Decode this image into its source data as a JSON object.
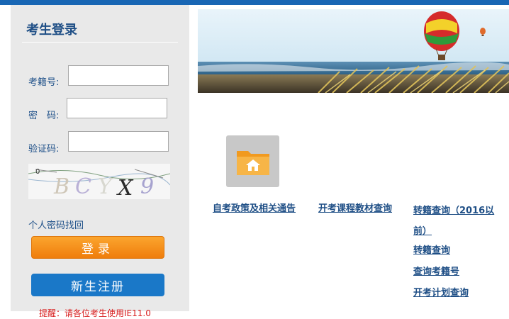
{
  "login": {
    "title": "考生登录",
    "exam_no_label": "考籍号:",
    "exam_no_value": "",
    "password_label": "密　码:",
    "password_value": "",
    "captcha_label": "验证码:",
    "captcha_value": "",
    "captcha_image_text": "BCYX9",
    "forgot_link": "个人密码找回",
    "login_button": "登录",
    "register_button": "新生注册",
    "notice": "提醒：请各位考生使用IE11.0"
  },
  "links": {
    "policy": "自考政策及相关通告",
    "textbooks": "开考课程教材查询",
    "transfer_2016": "转籍查询（2016以前）",
    "transfer": "转籍查询",
    "exam_no_query": "查询考籍号",
    "plan_query": "开考计划查询"
  },
  "colors": {
    "top_bar": "#1866b4",
    "login_button": "#f39215",
    "register_button": "#1a78c8",
    "link": "#1f4f86"
  },
  "icons": {
    "tile": "folder-home-icon"
  }
}
